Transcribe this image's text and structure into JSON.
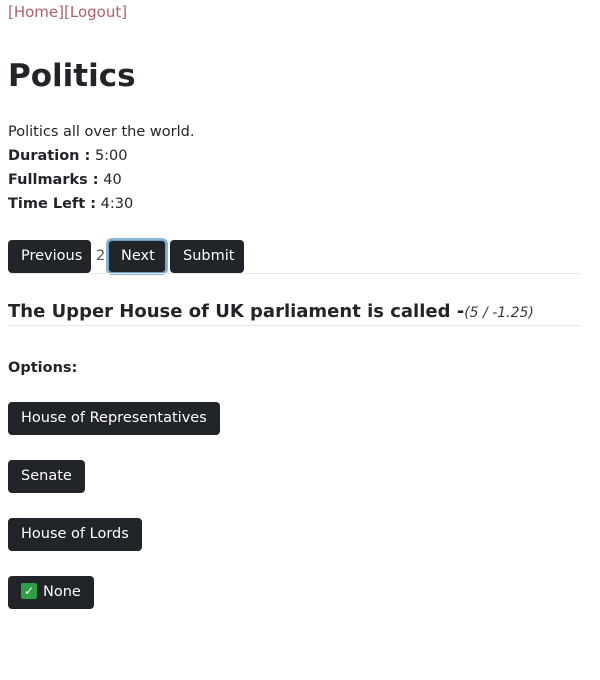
{
  "nav": {
    "home": "[Home]",
    "logout": "[Logout]"
  },
  "quiz": {
    "title": "Politics",
    "description": "Politics all over the world.",
    "duration_label": "Duration :",
    "duration_value": "5:00",
    "fullmarks_label": "Fullmarks :",
    "fullmarks_value": "40",
    "timeleft_label": "Time Left :",
    "timeleft_value": "4:30"
  },
  "pager": {
    "previous": "Previous",
    "current_page": "2",
    "next": "Next",
    "submit": "Submit"
  },
  "question": {
    "text": "The Upper House of UK parliament is called -",
    "marks": "(5 / -1.25)"
  },
  "options": {
    "label": "Options:",
    "items": [
      {
        "label": "House of Representatives",
        "selected": false
      },
      {
        "label": "Senate",
        "selected": false
      },
      {
        "label": "House of Lords",
        "selected": false
      },
      {
        "label": "None",
        "selected": true
      }
    ],
    "check_glyph": "✓"
  },
  "colors": {
    "button_bg": "#212529",
    "nav_link": "#b0606a",
    "check_bg": "#2ea043"
  }
}
